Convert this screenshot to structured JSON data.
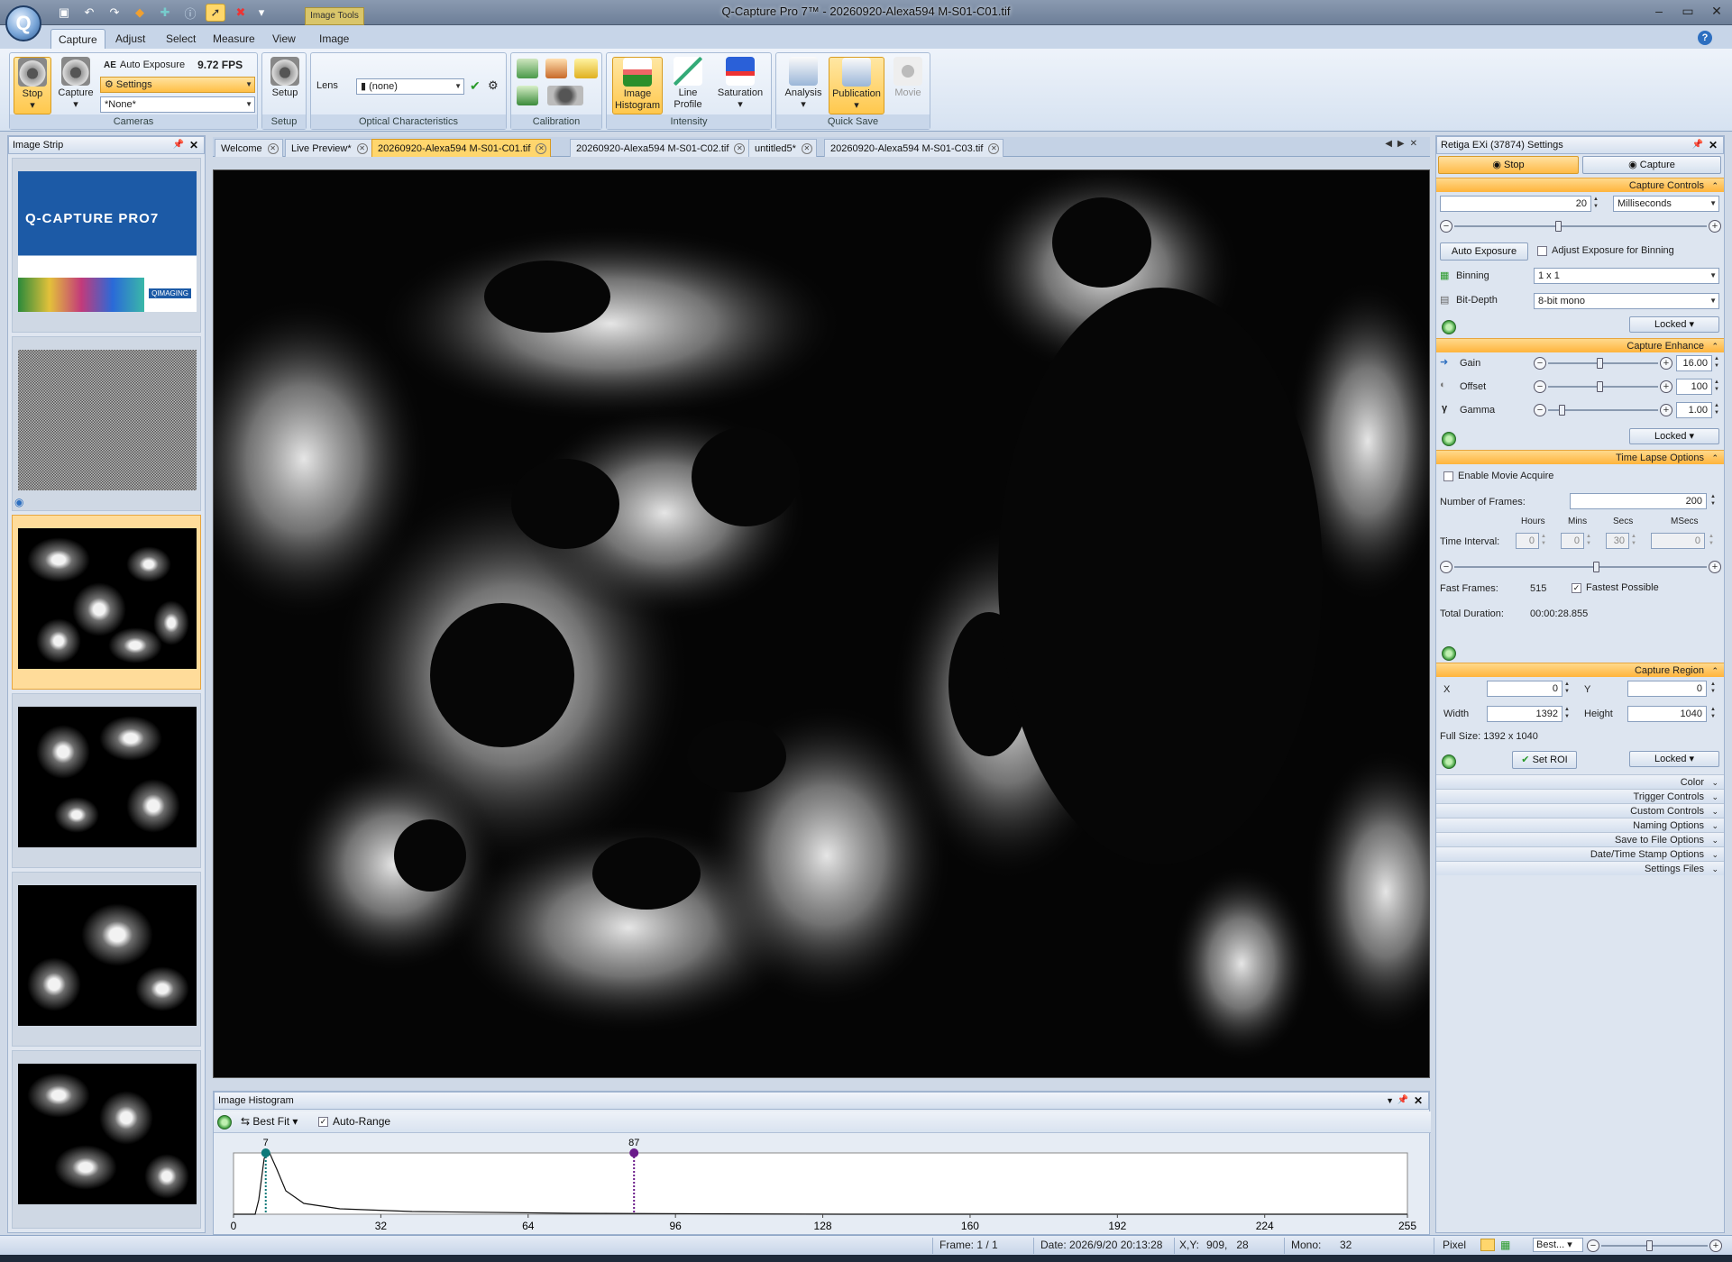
{
  "window": {
    "title": "Q-Capture Pro 7™ - 20260920-Alexa594 M-S01-C01.tif",
    "tool_context_tab": "Image Tools",
    "buttons": [
      "minimize",
      "maximize",
      "close"
    ]
  },
  "ribbon_tabs": [
    "Capture",
    "Adjust",
    "Select",
    "Measure",
    "View",
    "Image"
  ],
  "ribbon": {
    "cameras": {
      "stop_label": "Stop",
      "capture_label": "Capture",
      "auto_exposure_label": "Auto Exposure",
      "fps": "9.72 FPS",
      "settings_label": "Settings",
      "preset_value": "*None*",
      "group_label": "Cameras"
    },
    "setup": {
      "setup_label": "Setup",
      "group_label": "Setup"
    },
    "optical": {
      "lens_label": "Lens",
      "lens_value": "(none)",
      "group_label": "Optical Characteristics"
    },
    "calibration": {
      "group_label": "Calibration"
    },
    "intensity": {
      "image_histogram_label": "Image Histogram",
      "line_profile_label": "Line Profile",
      "saturation_label": "Saturation",
      "group_label": "Intensity"
    },
    "quicksave": {
      "analysis_label": "Analysis",
      "publication_label": "Publication",
      "movie_label": "Movie",
      "group_label": "Quick Save"
    }
  },
  "image_strip": {
    "title": "Image Strip",
    "splash_title": "Q-CAPTURE PRO7",
    "splash_brand": "QIMAGING"
  },
  "doc_tabs": [
    "Welcome",
    "Live Preview*",
    "20260920-Alexa594 M-S01-C01.tif",
    "20260920-Alexa594 M-S01-C02.tif",
    "untitled5*",
    "20260920-Alexa594 M-S01-C03.tif"
  ],
  "histogram": {
    "title": "Image Histogram",
    "best_fit_label": "Best Fit",
    "auto_range_label": "Auto-Range",
    "auto_range_checked": true,
    "low_marker": "7",
    "high_marker": "87",
    "low_value": 7,
    "high_value": 87,
    "x_ticks": [
      "0",
      "32",
      "64",
      "96",
      "128",
      "160",
      "192",
      "224",
      "255"
    ],
    "x_min": 0,
    "x_max": 255,
    "low_color": "#0e7a7a",
    "high_color": "#6a1a8a"
  },
  "settings": {
    "title": "Retiga EXi (37874) Settings",
    "stop_tab": "Stop",
    "capture_tab": "Capture",
    "capture_controls": {
      "header": "Capture Controls",
      "exposure_value": "20",
      "exposure_unit": "Milliseconds",
      "auto_exposure_button": "Auto Exposure",
      "adjust_binning_label": "Adjust Exposure for Binning",
      "binning_label": "Binning",
      "binning_value": "1 x 1",
      "bitdepth_label": "Bit-Depth",
      "bitdepth_value": "8-bit mono",
      "locked": "Locked"
    },
    "capture_enhance": {
      "header": "Capture Enhance",
      "gain_label": "Gain",
      "gain_value": "16.00",
      "offset_label": "Offset",
      "offset_value": "100",
      "gamma_label": "Gamma",
      "gamma_value": "1.00",
      "locked": "Locked"
    },
    "time_lapse": {
      "header": "Time Lapse Options",
      "enable_movie_label": "Enable Movie Acquire",
      "frames_label": "Number of Frames:",
      "frames_value": "200",
      "hours_label": "Hours",
      "mins_label": "Mins",
      "secs_label": "Secs",
      "msecs_label": "MSecs",
      "interval_label": "Time Interval:",
      "hours_value": "0",
      "mins_value": "0",
      "secs_value": "30",
      "msecs_value": "0",
      "fast_frames_label": "Fast Frames:",
      "fast_frames_value": "515",
      "fastest_label": "Fastest Possible",
      "total_duration_label": "Total Duration:",
      "total_duration_value": "00:00:28.855"
    },
    "capture_region": {
      "header": "Capture Region",
      "x_label": "X",
      "x_value": "0",
      "y_label": "Y",
      "y_value": "0",
      "width_label": "Width",
      "width_value": "1392",
      "height_label": "Height",
      "height_value": "1040",
      "full_size": "Full Size: 1392 x 1040",
      "set_roi_label": "Set ROI",
      "locked": "Locked"
    },
    "collapsed_sections": [
      "Color",
      "Trigger Controls",
      "Custom Controls",
      "Naming Options",
      "Save to File Options",
      "Date/Time Stamp Options",
      "Settings Files"
    ]
  },
  "status": {
    "frame": "Frame: 1 / 1",
    "date": "Date: 2026/9/20 20:13:28",
    "xy_label": "X,Y:",
    "xy_value": "909,   28",
    "mono_label": "Mono:",
    "mono_value": "32",
    "pixel": "Pixel",
    "zoom": "Best..."
  }
}
